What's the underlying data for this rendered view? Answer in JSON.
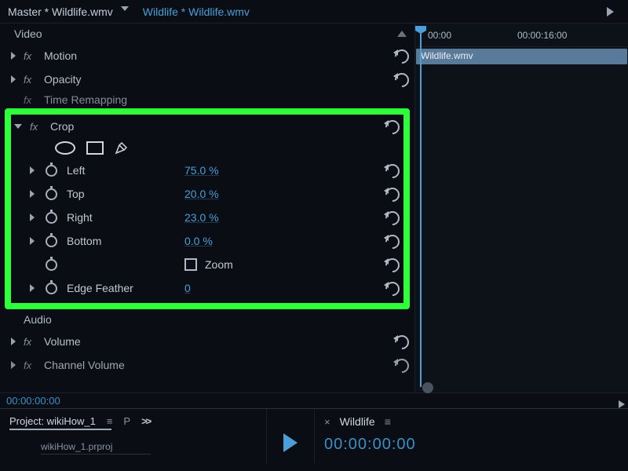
{
  "header": {
    "master_clip": "Master * Wildlife.wmv",
    "active_clip": "Wildlife * Wildlife.wmv"
  },
  "video_section": {
    "title": "Video",
    "effects": [
      {
        "name": "Motion"
      },
      {
        "name": "Opacity"
      },
      {
        "name": "Time Remapping"
      }
    ]
  },
  "crop": {
    "title": "Crop",
    "params": {
      "left": {
        "label": "Left",
        "value": "75.0 %"
      },
      "top": {
        "label": "Top",
        "value": "20.0 %"
      },
      "right": {
        "label": "Right",
        "value": "23.0 %"
      },
      "bottom": {
        "label": "Bottom",
        "value": "0.0 %"
      }
    },
    "zoom_label": "Zoom",
    "edge_feather": {
      "label": "Edge Feather",
      "value": "0"
    }
  },
  "audio_section": {
    "title": "Audio",
    "effects": [
      {
        "name": "Volume"
      },
      {
        "name": "Channel Volume"
      }
    ]
  },
  "timeline": {
    "start_tc": "00:00",
    "mark_tc": "00:00:16:00",
    "clip_name": "Wildlife.wmv",
    "current_tc": "00:00:00:00"
  },
  "project_panel": {
    "tab": "Project: wikiHow_1",
    "secondary": "P",
    "bin": "wikiHow_1.prproj"
  },
  "sequence_panel": {
    "tab": "Wildlife",
    "tc": "00:00:00:00"
  }
}
